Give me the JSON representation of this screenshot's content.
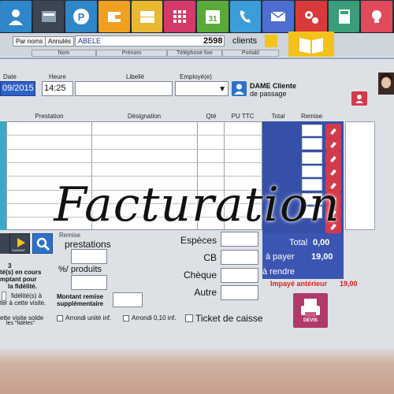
{
  "toolbar": {
    "icons": [
      {
        "name": "user-icon",
        "color": "#2f86c8"
      },
      {
        "name": "scanner-icon",
        "color": "#3b4652"
      },
      {
        "name": "parking-icon",
        "color": "#2f86c8"
      },
      {
        "name": "wallet-icon",
        "color": "#f0a020"
      },
      {
        "name": "drawer-icon",
        "color": "#e8b830"
      },
      {
        "name": "grid-icon",
        "color": "#d33a6a"
      },
      {
        "name": "calendar-icon",
        "color": "#5aaa3a",
        "day": "31"
      },
      {
        "name": "phone-icon",
        "color": "#3b9ed8"
      },
      {
        "name": "mail-icon",
        "color": "#4d6ed0"
      },
      {
        "name": "gears-icon",
        "color": "#d83a3a"
      },
      {
        "name": "calculator-icon",
        "color": "#3a9e78"
      },
      {
        "name": "bulb-icon",
        "color": "#e04a5a"
      }
    ]
  },
  "strip": {
    "tab1": "Par noms",
    "tab2": "Annulés",
    "name_value": "ABELE",
    "count": "2598",
    "count_label": "clients",
    "columns": [
      "Nom",
      "Prénom",
      "Téléphone fixe",
      "Portabl"
    ]
  },
  "form": {
    "labels": {
      "date": "Date",
      "heure": "Heure",
      "libelle": "Libellé",
      "employe": "Employé(e)"
    },
    "date_value": "09/2015",
    "time_value": "14:25",
    "client_name": "DAME Cliente",
    "client_sub": "de passage",
    "grid_headers": [
      "Prestation",
      "Désignation",
      "Qté",
      "PU TTC",
      "Total",
      "Remise"
    ],
    "left_panel": {
      "number": "3",
      "lines": [
        "té(s) en cours",
        "mptant pour",
        "la fidélité."
      ],
      "fidelite": "fidélité(s) à",
      "fidelite2": "ter à cette visite.",
      "solde": "ette visite solde",
      "solde2": "les \"fidèles\""
    },
    "nav_labels": {
      "play": "SUIVANT"
    },
    "remise": {
      "label_top": "Remise",
      "prestations": "prestations",
      "pct_produits": "%/  produits",
      "montant": "Montant remise",
      "supplementaire": "supplémentaire"
    },
    "arrondi_unite": "Arrondi unité inf.",
    "arrondi_010": "Arrondi 0,10 inf.",
    "payments": {
      "especes": "Espèces",
      "cb": "CB",
      "cheque": "Chèque",
      "autre": "Autre"
    },
    "totals": {
      "total_label": "Total",
      "total_value": "0,00",
      "apayer_label": "à payer",
      "apayer_value": "19,00",
      "arendre_label": "à rendre",
      "impaye_label": "Impayé antérieur",
      "impaye_value": "19,00"
    },
    "ticket": "Ticket de caisse",
    "devis": "DEVIS"
  },
  "overlay_title": "Facturation",
  "colors": {
    "blue_panel": "#3650a8",
    "red_button": "#d33a4c",
    "devis_button": "#b03a6a",
    "impaye": "#e02020"
  }
}
